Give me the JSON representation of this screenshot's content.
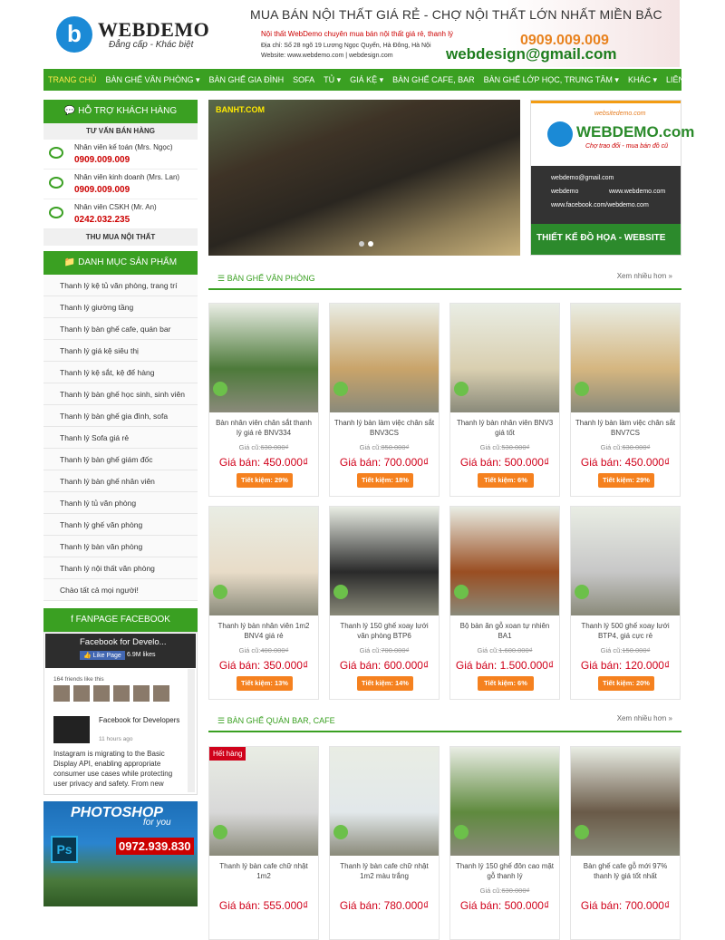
{
  "header": {
    "logo_name": "WEBDEMO",
    "logo_letter": "b",
    "slogan": "Đẳng cấp - Khác biệt",
    "banner_title": "MUA BÁN NỘI THẤT GIÁ RẺ - CHỢ NỘI THẤT LỚN NHẤT MIỀN BẮC",
    "banner_desc": "Nội thất WebDemo chuyên mua bán nội thất giá rẻ, thanh lý",
    "banner_addr": "Địa chỉ: Số 28 ngõ 19 Lương Ngọc Quyến, Hà Đông, Hà Nội",
    "banner_web": "Website: www.webdemo.com | webdesign.com",
    "banner_phone": "0909.009.009",
    "banner_email": "webdesign@gmail.com"
  },
  "nav": [
    "TRANG CHỦ",
    "BÀN GHẾ VĂN PHÒNG ▾",
    "BÀN GHẾ GIA ĐÌNH",
    "SOFA",
    "TỦ ▾",
    "GIÁ KỆ ▾",
    "BÀN GHẾ CAFE, BAR",
    "BÀN GHẾ LỚP HỌC, TRUNG TÂM ▾",
    "KHÁC ▾",
    "LIÊN HỆ"
  ],
  "sidebar": {
    "support_title": "💬 HỖ TRỢ KHÁCH HÀNG",
    "sales_title": "TƯ VẤN BÁN HÀNG",
    "supports": [
      {
        "name": "Nhân viên kế toán (Mrs. Ngọc)",
        "phone": "0909.009.009"
      },
      {
        "name": "Nhân viên kinh doanh (Mrs. Lan)",
        "phone": "0909.009.009"
      },
      {
        "name": "Nhân viên CSKH (Mr. An)",
        "phone": "0242.032.235"
      }
    ],
    "buy_title": "THU MUA NỘI THẤT",
    "cat_title": "📁 DANH MỤC SẢN PHẨM",
    "categories": [
      "Thanh lý kệ tủ văn phòng, trang trí",
      "Thanh lý giường tầng",
      "Thanh lý bàn ghế cafe, quán bar",
      "Thanh lý giá kệ siêu thị",
      "Thanh lý kệ sắt, kệ để hàng",
      "Thanh lý bàn ghế học sinh, sinh viên",
      "Thanh lý bàn ghế gia đình, sofa",
      "Thanh lý Sofa giá rẻ",
      "Thanh lý bàn ghế giám đốc",
      "Thanh lý bàn ghế nhân viên",
      "Thanh lý tủ văn phòng",
      "Thanh lý ghế văn phòng",
      "Thanh lý bàn văn phòng",
      "Thanh lý nội thất văn phòng",
      "Chào tất cả mọi người!"
    ],
    "fb_title": "f FANPAGE FACEBOOK",
    "fb_page": "Facebook for Develo...",
    "fb_like": "👍 Like Page",
    "fb_likes": "6.9M likes",
    "fb_friends": "164 friends like this",
    "fb_post_name": "Facebook for Developers",
    "fb_post_time": "11 hours ago",
    "fb_post_text": "Instagram is migrating to the Basic Display API, enabling appropriate consumer use cases while protecting user privacy and safety. From new",
    "ps_title": "PHOTOSHOP",
    "ps_for": "for you",
    "ps_logo": "Ps",
    "ps_phone": "0972.939.830"
  },
  "slider": {
    "brand": "BANHT.COM"
  },
  "ad": {
    "site": "websitedemo.com",
    "logo": "WEBDEMO.com",
    "sub": "Chợ trao đổi - mua bán đồ cũ",
    "lines": [
      "webdemo@gmail.com",
      "webdemo",
      "www.webdemo.com",
      "www.facebook.com/webdemo.com"
    ],
    "footer": "THIẾT KẾ ĐỒ HỌA - WEBSITE"
  },
  "sections": [
    {
      "title": "☰ BÀN GHẾ VĂN PHÒNG",
      "more": "Xem nhiều hơn »"
    },
    {
      "title": "☰ BÀN GHẾ QUÁN BAR, CAFE",
      "more": "Xem nhiều hơn »"
    }
  ],
  "products": [
    {
      "name": "Bàn nhân viên chân sắt thanh lý giá rẻ BNV334",
      "old": "630.000₫",
      "price": "Giá bán: 450.000₫",
      "save": "Tiết kiệm: 29%",
      "color": "#4d7a3a"
    },
    {
      "name": "Thanh lý bàn làm việc chân sắt BNV3CS",
      "old": "850.000₫",
      "price": "Giá bán: 700.000₫",
      "save": "Tiết kiệm: 18%",
      "color": "#c9a46a"
    },
    {
      "name": "Thanh lý bàn nhân viên BNV3 giá tốt",
      "old": "530.000₫",
      "price": "Giá bán: 500.000₫",
      "save": "Tiết kiệm: 6%",
      "color": "#d9cfb0"
    },
    {
      "name": "Thanh lý bàn làm việc chân sắt BNV7CS",
      "old": "630.000₫",
      "price": "Giá bán: 450.000₫",
      "save": "Tiết kiệm: 29%",
      "color": "#d5b680"
    },
    {
      "name": "Thanh lý bàn nhân viên 1m2 BNV4 giá rẻ",
      "old": "400.000₫",
      "price": "Giá bán: 350.000₫",
      "save": "Tiết kiệm: 13%",
      "color": "#e8dcc8"
    },
    {
      "name": "Thanh lý 150 ghế xoay lưới văn phòng BTP6",
      "old": "700.000₫",
      "price": "Giá bán: 600.000₫",
      "save": "Tiết kiệm: 14%",
      "color": "#2a2a2a"
    },
    {
      "name": "Bộ bàn ăn gỗ xoan tự nhiên BA1",
      "old": "1.600.000₫",
      "price": "Giá bán: 1.500.000₫",
      "save": "Tiết kiệm: 6%",
      "color": "#9a4e22"
    },
    {
      "name": "Thanh lý 500 ghế xoay lưới BTP4, giá cực rẻ",
      "old": "150.000₫",
      "price": "Giá bán: 120.000₫",
      "save": "Tiết kiệm: 20%",
      "color": "#c7c7c7"
    },
    {
      "name": "Thanh lý bàn cafe chữ nhật 1m2",
      "old": "",
      "price": "Giá bán: 555.000₫",
      "save": "",
      "color": "#d8d8d8",
      "hot": "Hết hàng"
    },
    {
      "name": "Thanh lý bàn cafe chữ nhật 1m2 màu trắng",
      "old": "",
      "price": "Giá bán: 780.000₫",
      "save": "",
      "color": "#e2e8ea"
    },
    {
      "name": "Thanh lý 150 ghế đôn cao mặt gỗ thanh lý",
      "old": "630.000₫",
      "price": "Giá bán: 500.000₫",
      "save": "",
      "color": "#5f8a3e"
    },
    {
      "name": "Bàn ghế cafe gỗ mới 97% thanh lý giá tốt nhất",
      "old": "",
      "price": "Giá bán: 700.000₫",
      "save": "",
      "color": "#6a5a48"
    }
  ],
  "old_label": "Giá cũ:"
}
